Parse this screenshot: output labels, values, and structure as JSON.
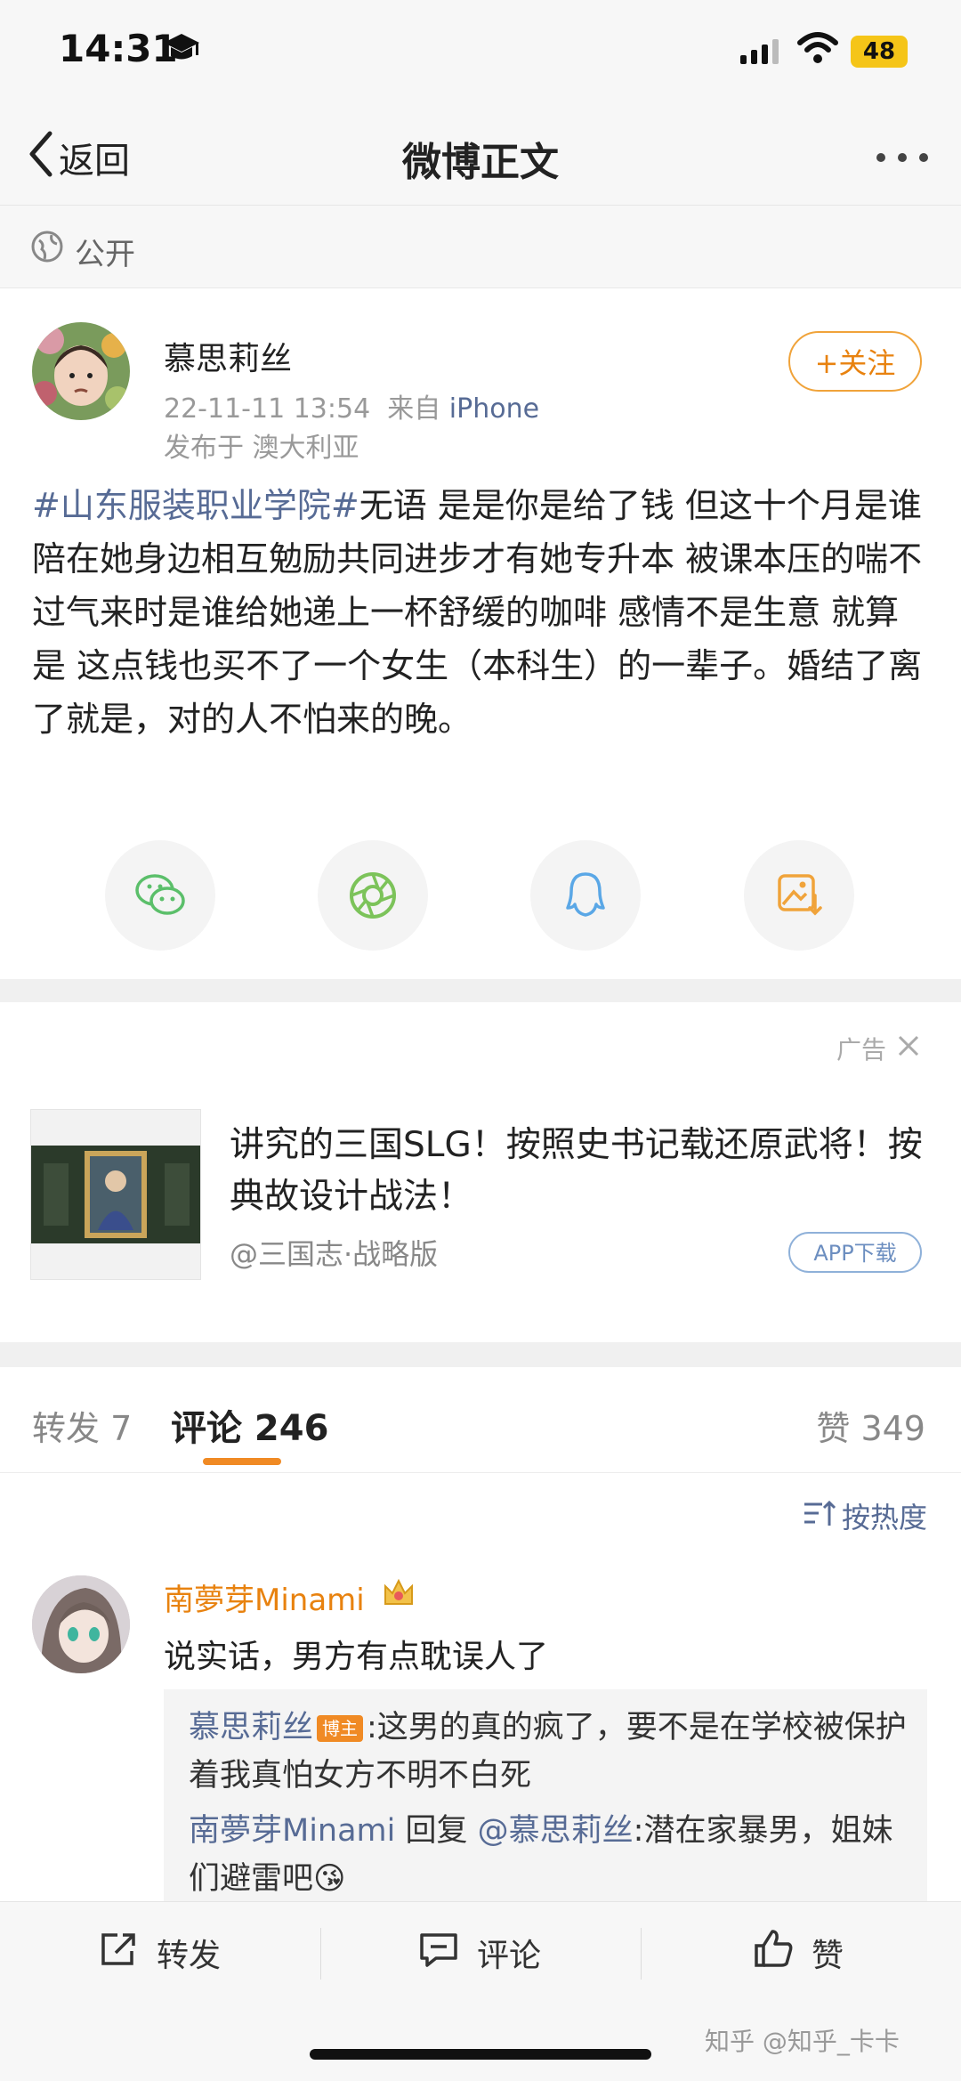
{
  "status_bar": {
    "time": "14:31",
    "battery": "48"
  },
  "nav": {
    "back_label": "返回",
    "title": "微博正文"
  },
  "visibility": {
    "label": "公开"
  },
  "post": {
    "author": "慕思莉丝",
    "timestamp": "22-11-11 13:54",
    "source_prefix": "来自",
    "source": "iPhone",
    "location": "发布于 澳大利亚",
    "follow_label": "+关注",
    "hashtag": "#山东服装职业学院#",
    "body": "无语 是是你是给了钱 但这十个月是谁陪在她身边相互勉励共同进步才有她专升本 被课本压的喘不过气来时是谁给她递上一杯舒缓的咖啡 感情不是生意 就算是 这点钱也买不了一个女生（本科生）的一辈子。婚结了离了就是，对的人不怕来的晚。"
  },
  "share": {
    "wechat_icon": "wechat-icon",
    "moments_icon": "moments-icon",
    "qq_icon": "qq-icon",
    "save_image_icon": "save-image-icon"
  },
  "ad": {
    "label": "广告",
    "title": "讲究的三国SLG！按照史书记载还原武将！按典故设计战法！",
    "source": "@三国志·战略版",
    "button": "APP下载"
  },
  "tabs": {
    "repost": "转发 7",
    "comment": "评论 246",
    "like": "赞 349",
    "sort": "按热度"
  },
  "comment": {
    "author": "南夢芽Minami",
    "text": "说实话，男方有点耽误人了",
    "replies": [
      {
        "name": "慕思莉丝",
        "badge": "博主",
        "text": ":这男的真的疯了，要不是在学校被保护着我真怕女方不明不白死"
      },
      {
        "name": "南夢芽Minami",
        "mid": " 回复 ",
        "mention": "@慕思莉丝",
        "text": ":潜在家暴男，姐妹们避雷吧😘"
      }
    ]
  },
  "bottom_bar": {
    "repost": "转发",
    "comment": "评论",
    "like": "赞"
  },
  "watermark": "知乎 @知乎_卡卡"
}
